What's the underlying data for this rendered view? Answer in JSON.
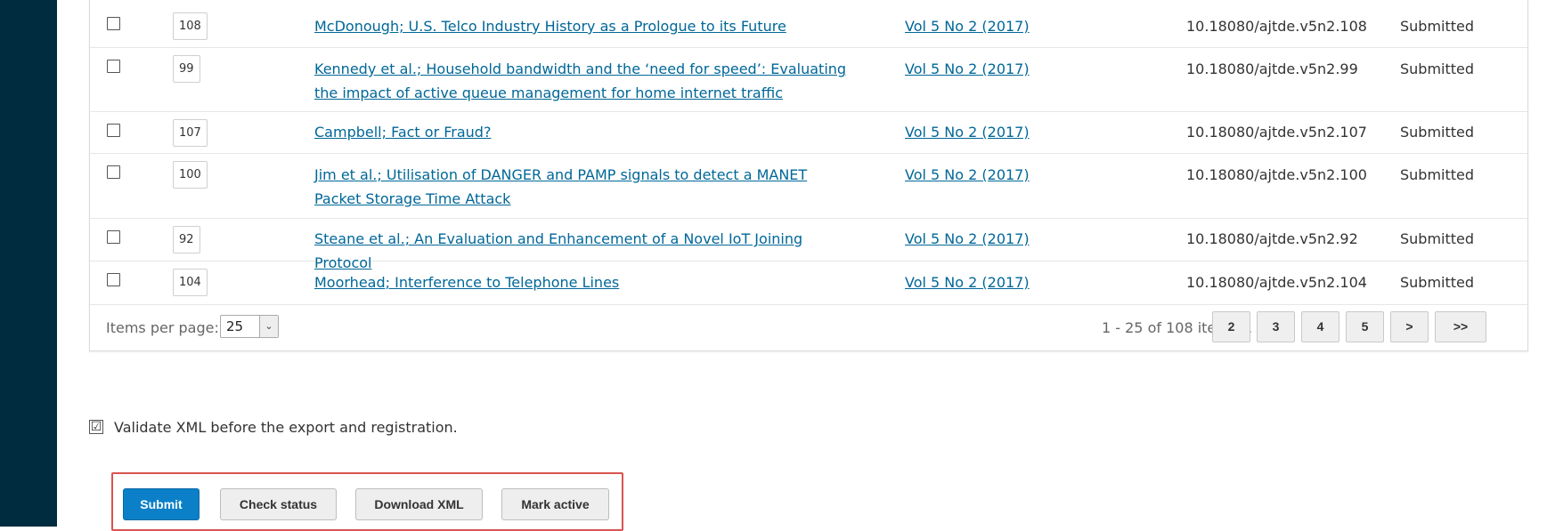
{
  "table": {
    "rows": [
      {
        "id": "108",
        "title": "McDonough; U.S. Telco Industry History as a Prologue to its Future",
        "issue": "Vol 5 No 2 (2017)",
        "doi": "10.18080/ajtde.v5n2.108",
        "status": "Submitted"
      },
      {
        "id": "99",
        "title": "Kennedy et al.; Household bandwidth and the ‘need for speed’: Evaluating the impact of active queue management for home internet traffic",
        "issue": "Vol 5 No 2 (2017)",
        "doi": "10.18080/ajtde.v5n2.99",
        "status": "Submitted"
      },
      {
        "id": "107",
        "title": "Campbell; Fact or Fraud?",
        "issue": "Vol 5 No 2 (2017)",
        "doi": "10.18080/ajtde.v5n2.107",
        "status": "Submitted"
      },
      {
        "id": "100",
        "title": "Jim et al.; Utilisation of DANGER and PAMP signals to detect a MANET Packet Storage Time Attack",
        "issue": "Vol 5 No 2 (2017)",
        "doi": "10.18080/ajtde.v5n2.100",
        "status": "Submitted"
      },
      {
        "id": "92",
        "title": "Steane et al.; An Evaluation and Enhancement of a Novel IoT Joining Protocol",
        "issue": "Vol 5 No 2 (2017)",
        "doi": "10.18080/ajtde.v5n2.92",
        "status": "Submitted"
      },
      {
        "id": "104",
        "title": "Moorhead; Interference to Telephone Lines",
        "issue": "Vol 5 No 2 (2017)",
        "doi": "10.18080/ajtde.v5n2.104",
        "status": "Submitted"
      }
    ]
  },
  "pagination": {
    "items_per_page_label": "Items per page:",
    "items_per_page_value": "25",
    "select_arrow": "⌄",
    "range_text": "1 - 25 of 108 items",
    "current_page": "1",
    "pages": [
      "2",
      "3",
      "4",
      "5"
    ],
    "next_label": ">",
    "last_label": ">>"
  },
  "validate": {
    "label": "Validate XML before the export and registration.",
    "checked": true,
    "check_mark": "☑"
  },
  "actions": {
    "submit": "Submit",
    "check_status": "Check status",
    "download_xml": "Download XML",
    "mark_active": "Mark active"
  },
  "colors": {
    "sidebar": "#002c40",
    "link": "#006798",
    "primary": "#0b80c8",
    "highlight_border": "#d9534f"
  }
}
